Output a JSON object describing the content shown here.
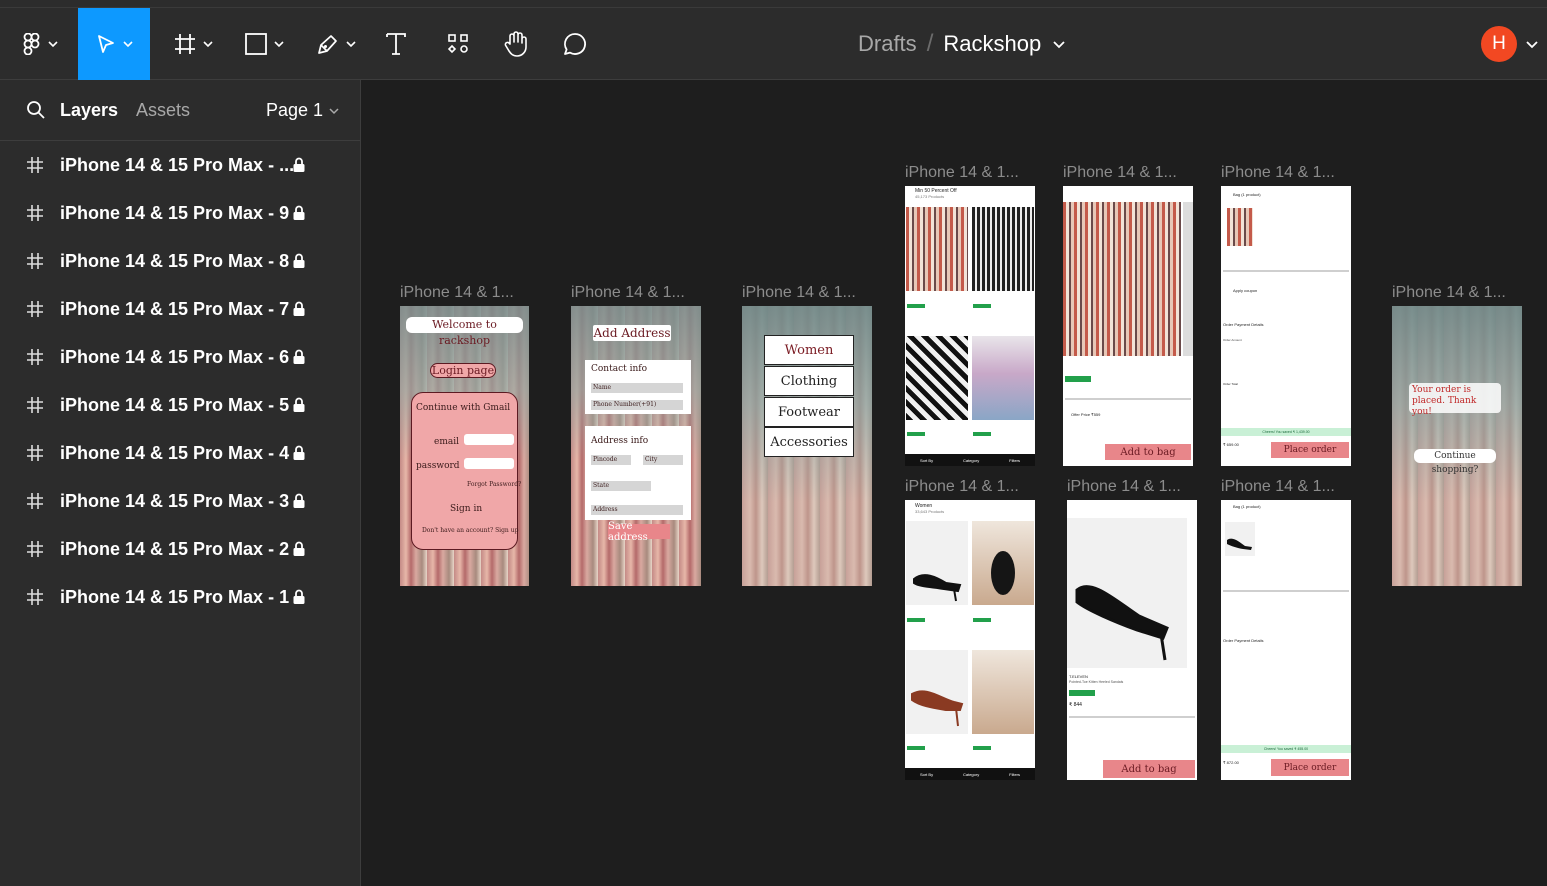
{
  "toolbar": {
    "breadcrumb_drafts": "Drafts",
    "breadcrumb_separator": "/",
    "file_name": "Rackshop",
    "avatar_initial": "H",
    "accent_color": "#0d99ff"
  },
  "sidebar": {
    "tab_layers": "Layers",
    "tab_assets": "Assets",
    "page_selector": "Page 1",
    "layers": [
      {
        "label": "iPhone 14 & 15 Pro Max - ..."
      },
      {
        "label": "iPhone 14 & 15 Pro Max - 9"
      },
      {
        "label": "iPhone 14 & 15 Pro Max - 8"
      },
      {
        "label": "iPhone 14 & 15 Pro Max - 7"
      },
      {
        "label": "iPhone 14 & 15 Pro Max - 6"
      },
      {
        "label": "iPhone 14 & 15 Pro Max - 5"
      },
      {
        "label": "iPhone 14 & 15 Pro Max - 4"
      },
      {
        "label": "iPhone 14 & 15 Pro Max - 3"
      },
      {
        "label": "iPhone 14 & 15 Pro Max - 2"
      },
      {
        "label": "iPhone 14 & 15 Pro Max - 1"
      }
    ]
  },
  "canvas": {
    "frame_label": "iPhone 14 & 1...",
    "frame1": {
      "welcome": "Welcome to rackshop",
      "login_page": "Login page",
      "continue_gmail": "Continue with Gmail",
      "email": "email",
      "password": "password",
      "forgot": "Forgot Password?",
      "sign_in": "Sign in",
      "signup": "Don't have an account? Sign up"
    },
    "frame2": {
      "title": "Add Address",
      "contact_info": "Contact info",
      "name": "Name",
      "phone": "Phone Number(+91)",
      "address_info": "Address info",
      "pincode": "Pincode",
      "city": "City",
      "state": "State",
      "address": "Address",
      "save": "Save address"
    },
    "frame3": {
      "menu": [
        "Women",
        "Clothing",
        "Footwear",
        "Accessories"
      ]
    },
    "shop_a": {
      "header": "Min 50 Percent Off",
      "sub": "45,173 Products",
      "sort": "Sort By",
      "category": "Category",
      "filters": "Filters"
    },
    "product_top": {
      "add_to_bag": "Add to bag",
      "offer": "Offer Price ₹559"
    },
    "bag_top": {
      "title": "Bag (1 product)",
      "apply_coupon": "Apply coupon",
      "order_details": "Order Payment Details",
      "order_amount": "Order Amount",
      "order_total": "Order Total",
      "cheers": "Cheers! You saved ₹ 1,439.00",
      "place_order": "Place order",
      "total": "₹ 659.00"
    },
    "shop_b": {
      "header": "Women",
      "sub": "33,643 Products"
    },
    "product_bottom": {
      "brand": "T.ELEVEN",
      "name": "Pointed-Toe Kitten Heeled Sandals",
      "price": "₹ 844",
      "add_to_bag": "Add to bag"
    },
    "bag_bottom": {
      "title": "Bag (1 product)",
      "order_details": "Order Payment Details",
      "cheers": "Cheers! You saved ₹ 455.00",
      "place_order": "Place order",
      "total": "₹ 872.00"
    },
    "frame_last": {
      "placed": "Your order is placed. Thank you!",
      "continue": "Continue shopping?"
    }
  }
}
